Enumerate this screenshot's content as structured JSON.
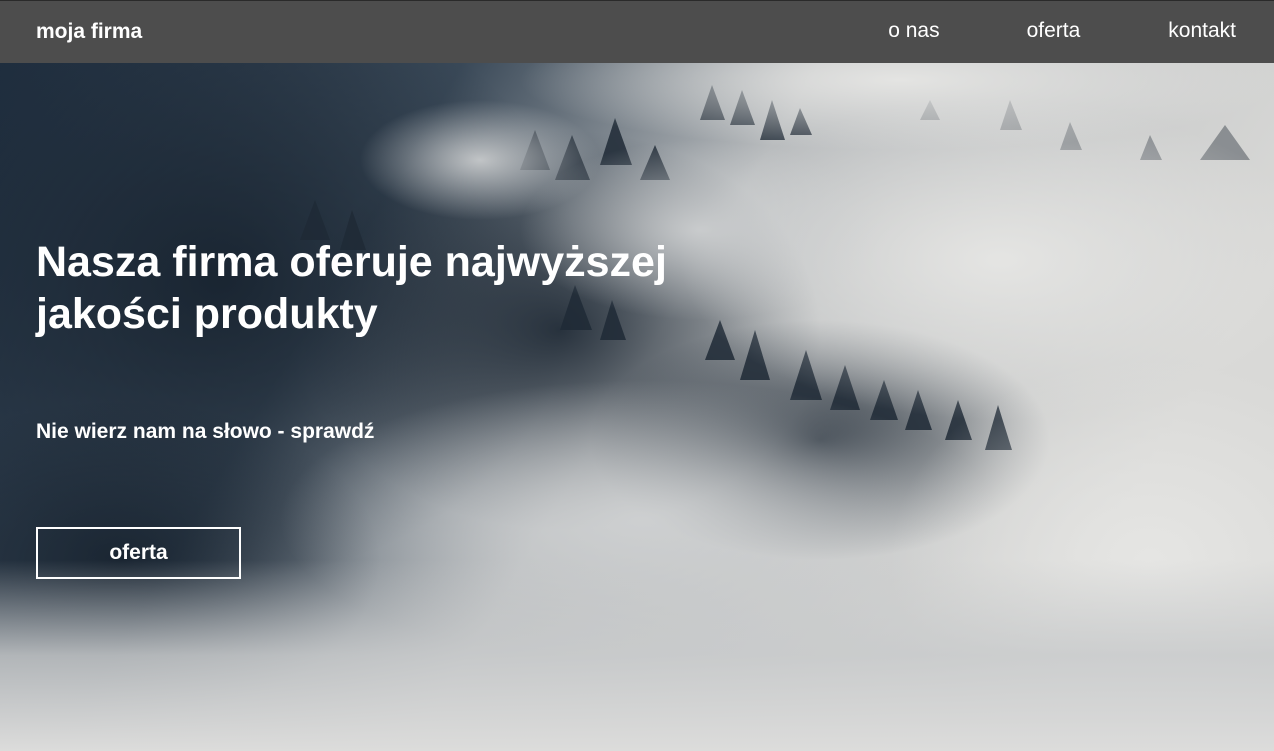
{
  "header": {
    "brand": "moja firma",
    "nav": [
      {
        "label": "o nas"
      },
      {
        "label": "oferta"
      },
      {
        "label": "kontakt"
      }
    ]
  },
  "hero": {
    "headline": "Nasza firma oferuje najwyższej jakości produkty",
    "subline": "Nie wierz nam na słowo - sprawdź",
    "cta_label": "oferta"
  },
  "colors": {
    "header_bg": "#4d4d4d",
    "text": "#ffffff"
  }
}
